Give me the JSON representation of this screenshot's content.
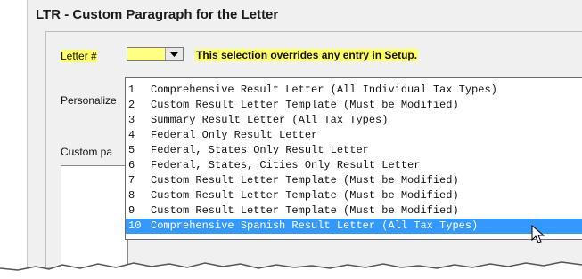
{
  "dialog": {
    "title": "LTR - Custom Paragraph for the Letter"
  },
  "form": {
    "letter_label": "Letter #",
    "letter_value": "",
    "override_note": "This selection overrides any entry in Setup.",
    "personalize_label": "Personalize",
    "custom_label": "Custom pa"
  },
  "dropdown": {
    "items": [
      {
        "num": "1",
        "text": "Comprehensive Result Letter (All Individual Tax Types)"
      },
      {
        "num": "2",
        "text": "Custom Result Letter Template (Must be Modified)"
      },
      {
        "num": "3",
        "text": "Summary Result Letter (All Tax Types)"
      },
      {
        "num": "4",
        "text": "Federal Only Result Letter"
      },
      {
        "num": "5",
        "text": "Federal, States Only Result Letter"
      },
      {
        "num": "6",
        "text": "Federal, States, Cities Only Result Letter"
      },
      {
        "num": "7",
        "text": "Custom Result Letter Template (Must be Modified)"
      },
      {
        "num": "8",
        "text": "Custom Result Letter Template (Must be Modified)"
      },
      {
        "num": "9",
        "text": "Custom Result Letter Template (Must be Modified)"
      },
      {
        "num": "10",
        "text": "Comprehensive Spanish Result Letter (All Tax Types)"
      }
    ],
    "selected_index": 9
  },
  "colors": {
    "highlight": "#ffff66",
    "selection": "#3399ff"
  },
  "icons": {
    "combo_arrow": "chevron-down-icon",
    "cursor": "mouse-pointer-icon"
  }
}
